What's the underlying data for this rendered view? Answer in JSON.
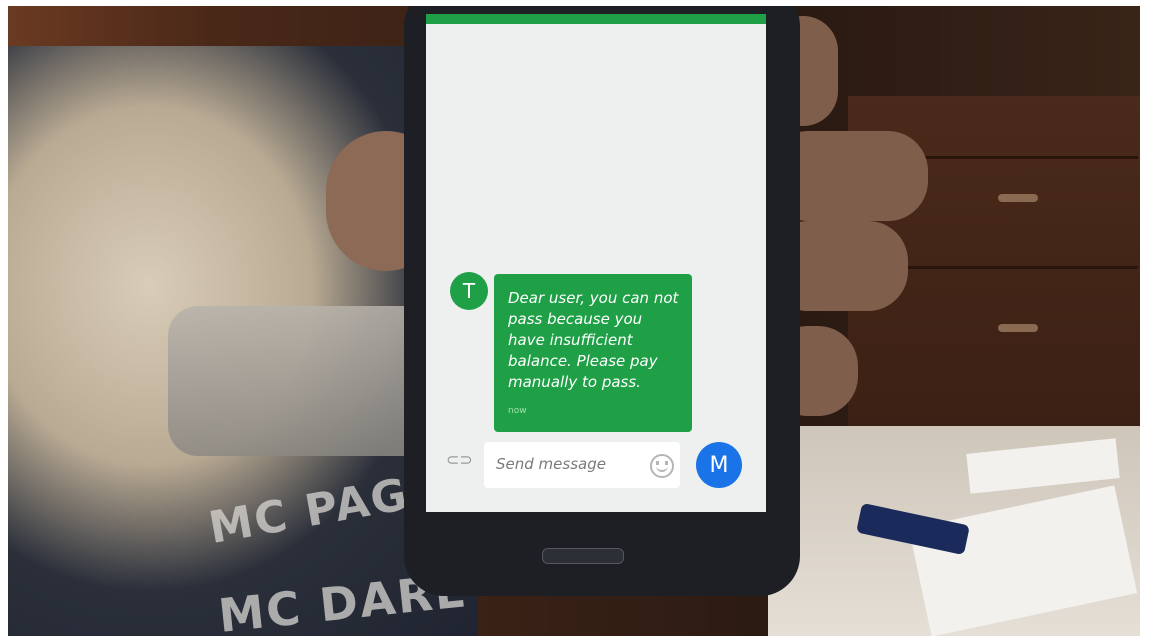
{
  "message": {
    "avatar_letter": "T",
    "body": "Dear user, you can not pass because you have insufficient balance. Please pay manually to pass.",
    "time": "now"
  },
  "composer": {
    "placeholder": "Send message",
    "send_letter": "M"
  },
  "shirt_print": {
    "line1": "MC PAG",
    "line2": "MC DARE"
  },
  "colors": {
    "accent_green": "#1fa047",
    "send_blue": "#1b73e8"
  }
}
